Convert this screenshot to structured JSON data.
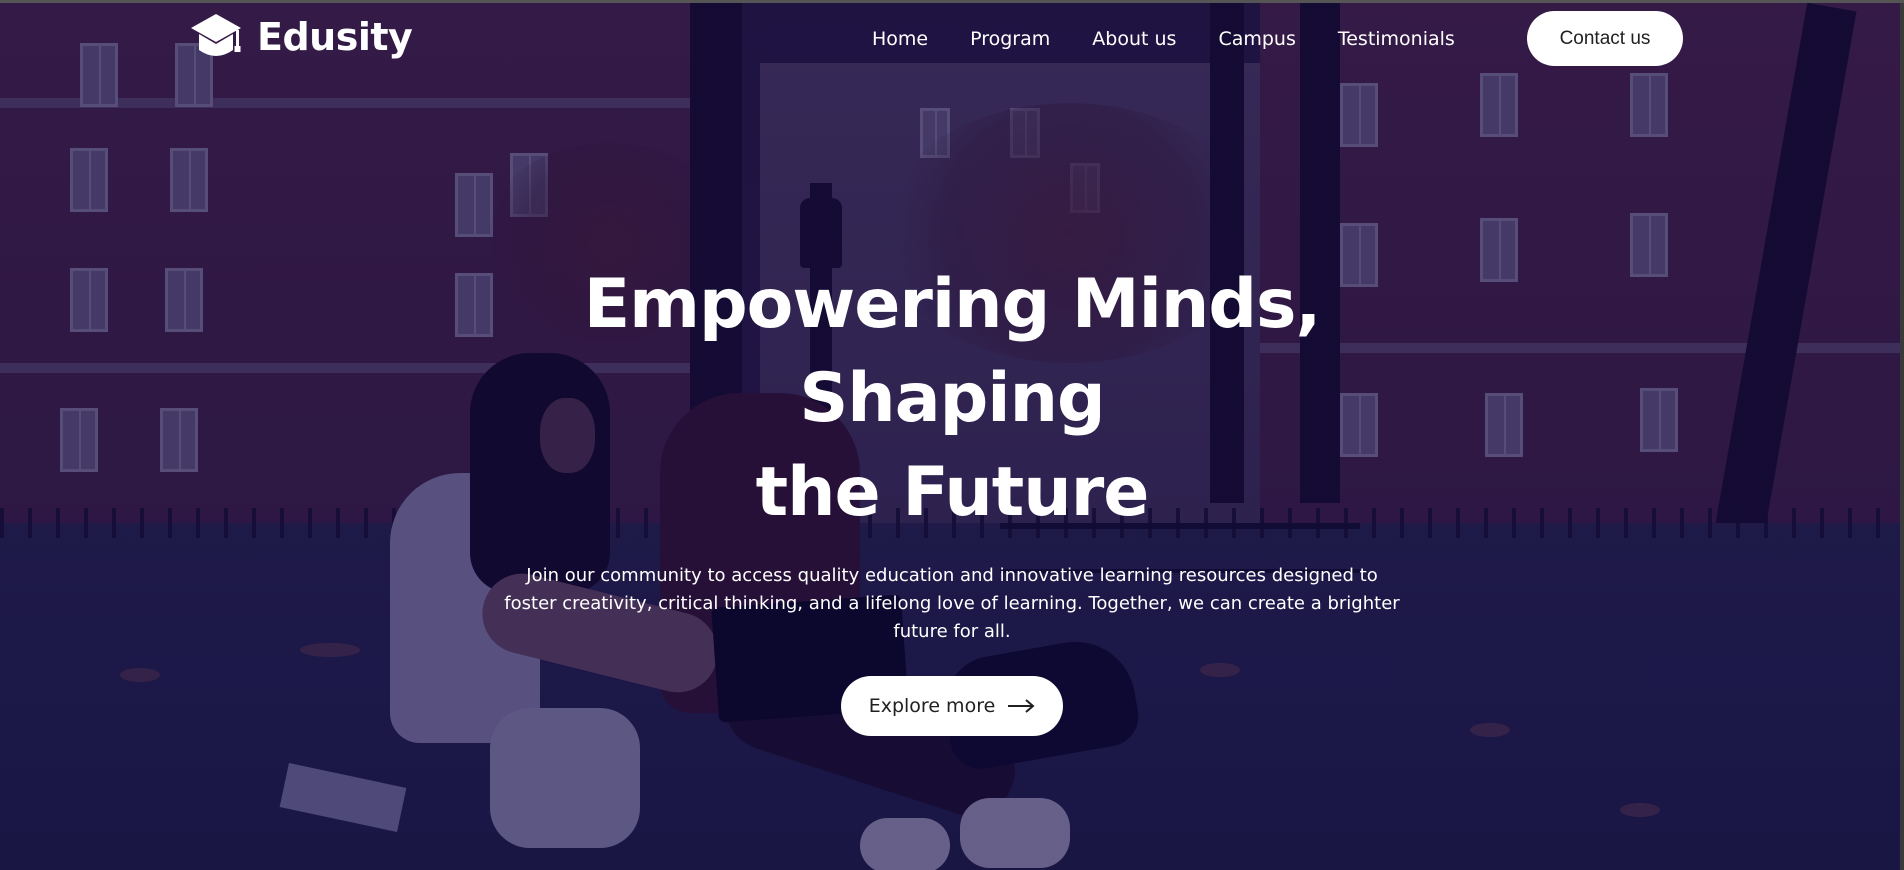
{
  "brand": {
    "name": "Edusity",
    "logo_icon": "graduation-cap-icon"
  },
  "nav": {
    "links": [
      "Home",
      "Program",
      "About us",
      "Campus",
      "Testimonials"
    ],
    "contact_label": "Contact us"
  },
  "hero": {
    "title_line1": "Empowering Minds, Shaping",
    "title_line2": "the Future",
    "description": "Join our community to access quality education and innovative learning resources designed to foster creativity, critical thinking, and a lifelong love of learning. Together, we can create a brighter future for all.",
    "cta_label": "Explore more",
    "cta_icon": "arrow-right-icon"
  },
  "colors": {
    "overlay": "#08003a",
    "button_bg": "#ffffff",
    "button_text": "#212121",
    "text": "#ffffff"
  }
}
